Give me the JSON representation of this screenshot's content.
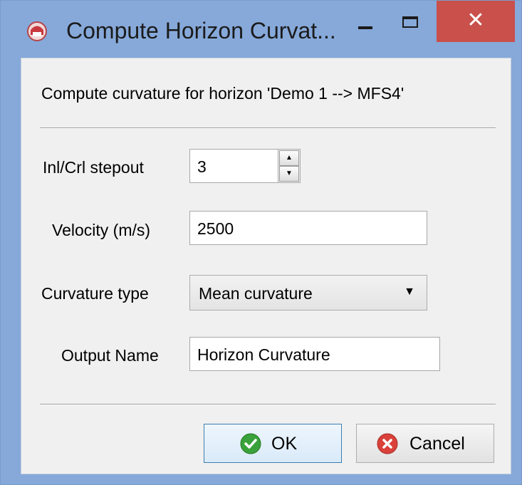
{
  "window": {
    "title": "Compute Horizon Curvat...",
    "close_symbol": "✕"
  },
  "dialog": {
    "message": "Compute curvature for horizon 'Demo 1 --> MFS4'",
    "stepout": {
      "label": "Inl/Crl stepout",
      "value": "3"
    },
    "velocity": {
      "label": "Velocity (m/s)",
      "value": "2500"
    },
    "curvature_type": {
      "label": "Curvature type",
      "selected": "Mean curvature"
    },
    "output_name": {
      "label": "Output Name",
      "value": "Horizon Curvature"
    }
  },
  "buttons": {
    "ok_label": "OK",
    "cancel_label": "Cancel"
  },
  "icons": {
    "app": "app-icon",
    "ok": "checkmark-icon",
    "cancel": "cross-circle-icon",
    "spin_up": "arrow-up-icon",
    "spin_down": "arrow-down-icon",
    "dropdown": "chevron-down-icon"
  },
  "colors": {
    "titlebar": "#86a9da",
    "close_button": "#c9504b",
    "ok_icon": "#3aa23a",
    "cancel_icon": "#d9413a"
  }
}
